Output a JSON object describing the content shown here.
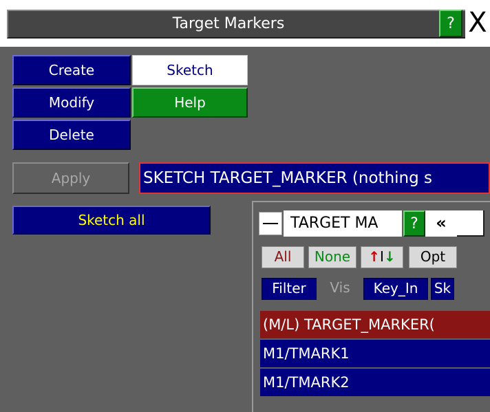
{
  "window": {
    "title": "Target Markers",
    "help_label": "?",
    "close_label": "X"
  },
  "actions": {
    "create": "Create",
    "modify": "Modify",
    "delete": "Delete",
    "sketch": "Sketch",
    "help": "Help",
    "apply": "Apply",
    "sketch_all": "Sketch all"
  },
  "status": {
    "text": "SKETCH TARGET_MARKER (nothing s"
  },
  "object_menu": {
    "title": "TARGET MA",
    "help_label": "?",
    "collapse_label": "«",
    "buttons": {
      "all": "All",
      "none": "None",
      "swap_up": "↑",
      "swap_bar": "I",
      "swap_down": "↓",
      "opt": "Opt",
      "filter": "Filter",
      "vis": "Vis",
      "key_in": "Key_In",
      "sk": "Sk"
    },
    "list": {
      "header": "(M/L) TARGET_MARKER(",
      "items": [
        "M1/TMARK1",
        "M1/TMARK2"
      ]
    }
  },
  "colors": {
    "panel_bg": "#5f5f5f",
    "navy": "#000080",
    "green": "#0a8a17",
    "dark_red": "#8a1515",
    "highlight_text": "#ffff00"
  }
}
